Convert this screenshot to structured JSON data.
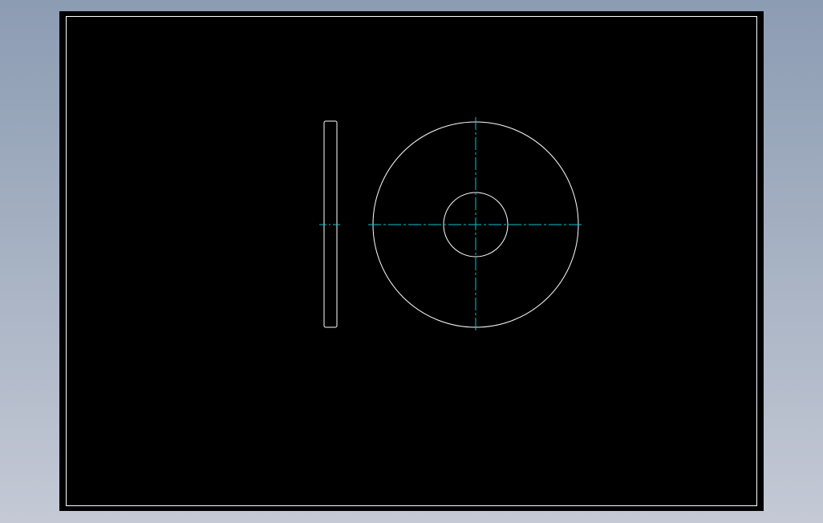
{
  "colors": {
    "background_top": "#8c9cb3",
    "background_bottom": "#c4c9d5",
    "sheet": "#000000",
    "outline": "#ffffff",
    "centerline": "#00c8d8"
  },
  "drawing": {
    "views": [
      {
        "name": "side-view",
        "shape": "thin-rounded-rectangle"
      },
      {
        "name": "front-view",
        "shape": "washer",
        "features": [
          "outer-circle",
          "inner-hole"
        ]
      }
    ],
    "centerline_style": "dash-dot"
  }
}
